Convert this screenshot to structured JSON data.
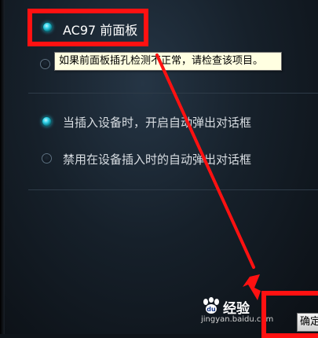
{
  "connector_options": {
    "ac97_label": "AC97 前面板",
    "ac97_selected": true,
    "second_option_selected": false
  },
  "tooltip": {
    "text": "如果前面板插孔检测不正常，请检查该项目。"
  },
  "dialog_options": {
    "items": [
      {
        "label": "当插入设备时，开启自动弹出对话框",
        "selected": true
      },
      {
        "label": "禁用在设备插入时的自动弹出对话框",
        "selected": false
      }
    ]
  },
  "buttons": {
    "ok_label": "确定"
  },
  "watermark": {
    "brand": "经验",
    "url": "jingyan.baidu.com"
  },
  "colors": {
    "annotation": "#ff1111",
    "radio_selected": "#2fd0e8",
    "background": "#16202a"
  }
}
